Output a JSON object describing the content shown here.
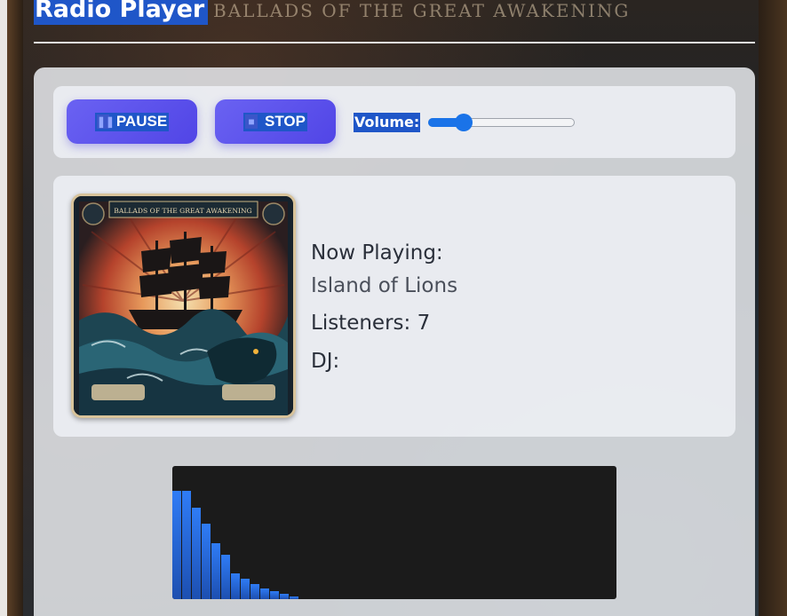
{
  "header": {
    "title": "Radio Player",
    "banner_text": "BALLADS OF THE GREAT AWAKENING"
  },
  "controls": {
    "pause_label": "PAUSE",
    "pause_icon": "pause-icon",
    "stop_label": "STOP",
    "stop_icon": "stop-icon",
    "volume_label": "Volume:",
    "volume_level": 0.24
  },
  "now_playing": {
    "cover_title": "BALLADS OF THE GREAT AWAKENING",
    "label": "Now Playing:",
    "song": "Island of Lions",
    "listeners_label": "Listeners:",
    "listeners_count": "7",
    "dj_label": "DJ:",
    "dj_name": ""
  },
  "visualizer": {
    "levels": [
      0.81,
      0.81,
      0.69,
      0.57,
      0.42,
      0.33,
      0.19,
      0.15,
      0.11,
      0.08,
      0.06,
      0.04,
      0.02
    ]
  },
  "colors": {
    "accent": "#5a4ff0",
    "highlight": "#1f56c8",
    "slider": "#1a73e8",
    "bar": "#2f7cf6"
  }
}
